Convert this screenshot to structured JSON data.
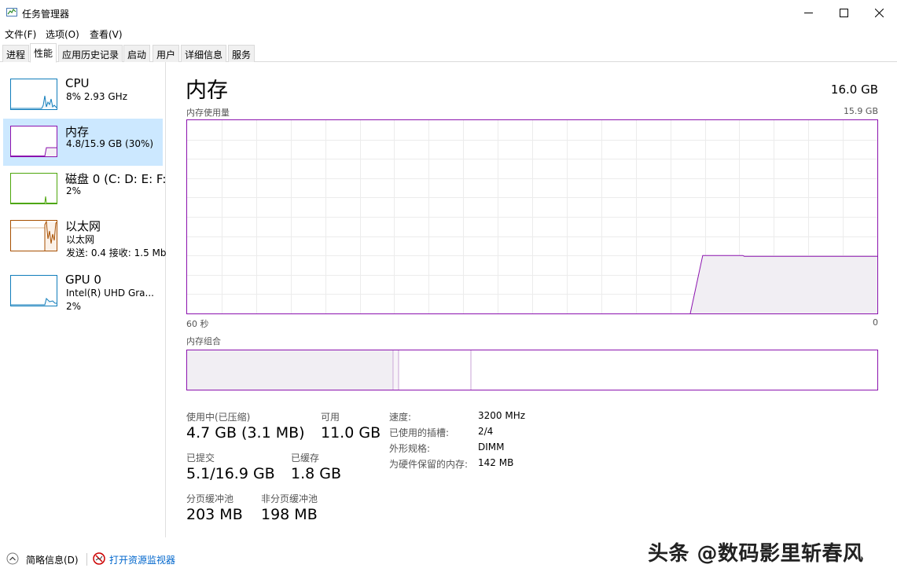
{
  "window": {
    "title": "任务管理器",
    "icon": "task-manager-icon"
  },
  "menu": [
    "文件(F)",
    "选项(O)",
    "查看(V)"
  ],
  "tabs": [
    "进程",
    "性能",
    "应用历史记录",
    "启动",
    "用户",
    "详细信息",
    "服务"
  ],
  "active_tab": "性能",
  "sidebar": [
    {
      "name": "CPU",
      "sub1": "8%  2.93 GHz",
      "color": "#117dbb"
    },
    {
      "name": "内存",
      "sub1": "4.8/15.9 GB (30%)",
      "color": "#8b12ae"
    },
    {
      "name": "磁盘 0 (C: D: E: F:",
      "sub1": "2%",
      "color": "#4da60c"
    },
    {
      "name": "以太网",
      "sub1": "以太网",
      "sub2": "发送: 0.4  接收: 1.5 Mb",
      "color": "#a74f01"
    },
    {
      "name": "GPU 0",
      "sub1": "Intel(R) UHD Gra...",
      "sub2": "2%",
      "color": "#117dbb"
    }
  ],
  "memory": {
    "title": "内存",
    "total": "16.0 GB",
    "usage_label": "内存使用量",
    "usage_max": "15.9 GB",
    "time_left": "60 秒",
    "time_right": "0",
    "composition_label": "内存组合",
    "usage_fraction": 0.3,
    "stats": {
      "in_use_label": "使用中(已压缩)",
      "in_use_value": "4.7 GB (3.1 MB)",
      "available_label": "可用",
      "available_value": "11.0 GB",
      "committed_label": "已提交",
      "committed_value": "5.1/16.9 GB",
      "cached_label": "已缓存",
      "cached_value": "1.8 GB",
      "paged_label": "分页缓冲池",
      "paged_value": "203 MB",
      "nonpaged_label": "非分页缓冲池",
      "nonpaged_value": "198 MB"
    },
    "info": {
      "speed_label": "速度:",
      "speed_value": "3200 MHz",
      "slots_label": "已使用的插槽:",
      "slots_value": "2/4",
      "form_label": "外形规格:",
      "form_value": "DIMM",
      "reserved_label": "为硬件保留的内存:",
      "reserved_value": "142 MB"
    }
  },
  "footer": {
    "fewer_details": "简略信息(D)",
    "open_resmon": "打开资源监视器"
  },
  "watermark": "头条 @数码影里斩春风"
}
